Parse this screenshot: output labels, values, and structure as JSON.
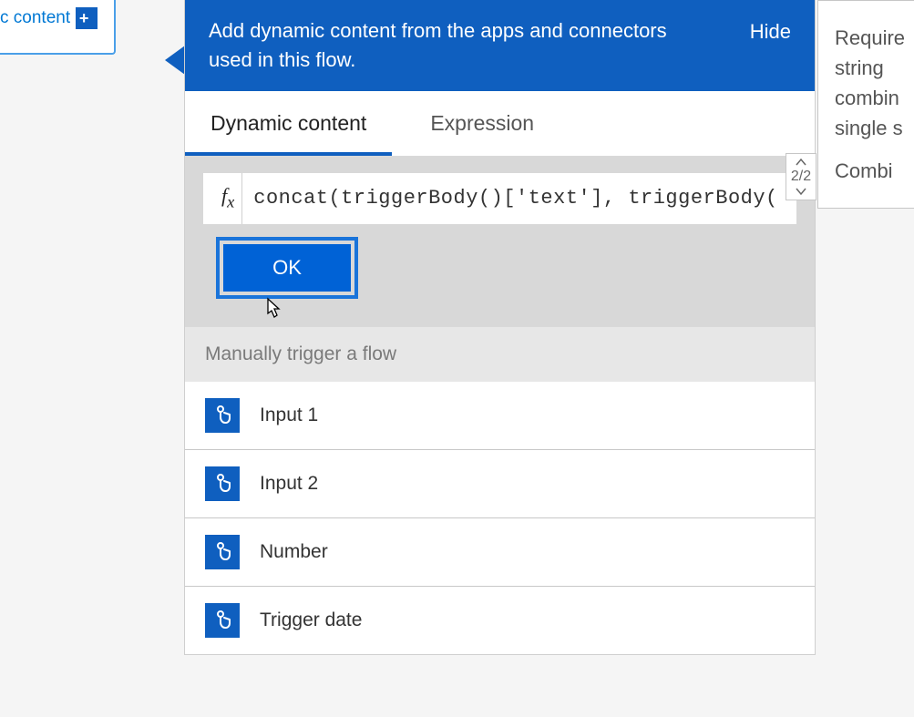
{
  "parent": {
    "link_text_fragment": "c content",
    "add_icon_label": "+"
  },
  "panel": {
    "header_text": "Add dynamic content from the apps and connectors used in this flow.",
    "hide_label": "Hide",
    "tabs": {
      "dynamic": "Dynamic content",
      "expression": "Expression"
    },
    "formula": "concat(triggerBody()['text'], triggerBody(",
    "ok_label": "OK",
    "section_title": "Manually trigger a flow",
    "items": [
      {
        "label": "Input 1"
      },
      {
        "label": "Input 2"
      },
      {
        "label": "Number"
      },
      {
        "label": "Trigger date"
      }
    ]
  },
  "spinner": {
    "value": "2/2"
  },
  "tooltip": {
    "line1": "Require",
    "line2": "string",
    "line3": "combin",
    "line4": "single s",
    "line5": "Combi"
  }
}
